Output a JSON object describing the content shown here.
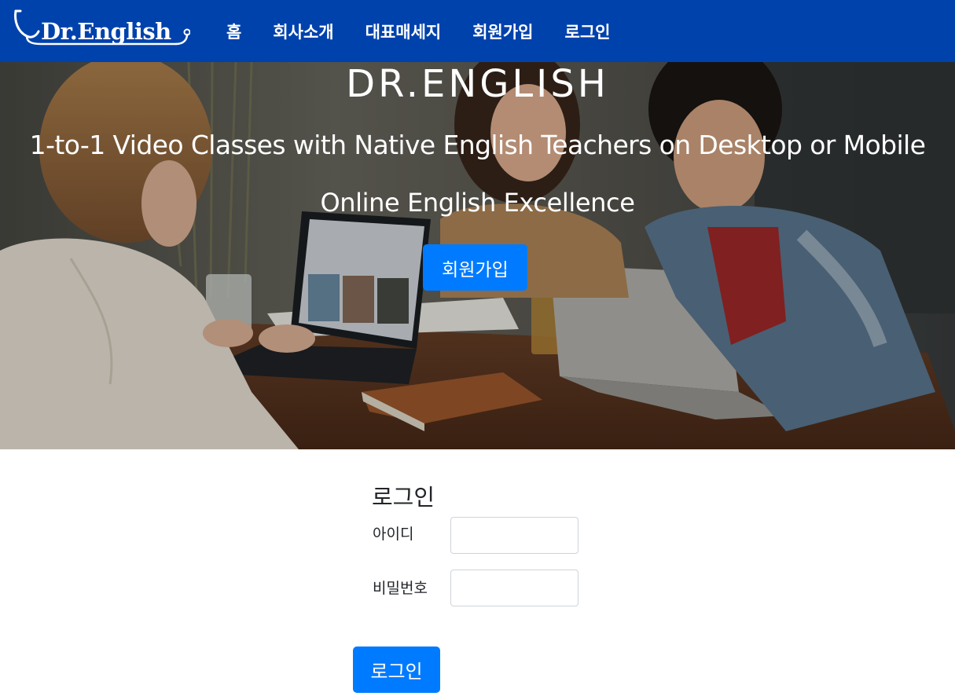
{
  "navbar": {
    "logo_text": "Dr.English",
    "links": [
      {
        "label": "홈"
      },
      {
        "label": "회사소개"
      },
      {
        "label": "대표매세지"
      },
      {
        "label": "회원가입"
      },
      {
        "label": "로그인"
      }
    ],
    "background_color": "#0042ac"
  },
  "hero": {
    "title": "DR.ENGLISH",
    "subtitle": "1-to-1 Video Classes with Native English Teachers on Desktop or Mobile",
    "tagline": "Online English Excellence",
    "signup_button": "회원가입",
    "background_image": "photo of students laughing around a table with laptops"
  },
  "login": {
    "title": "로그인",
    "id_label": "아이디",
    "id_value": "",
    "password_label": "비밀번호",
    "password_value": "",
    "submit_button": "로그인"
  },
  "colors": {
    "primary_button": "#007bff",
    "navbar": "#0042ac"
  }
}
